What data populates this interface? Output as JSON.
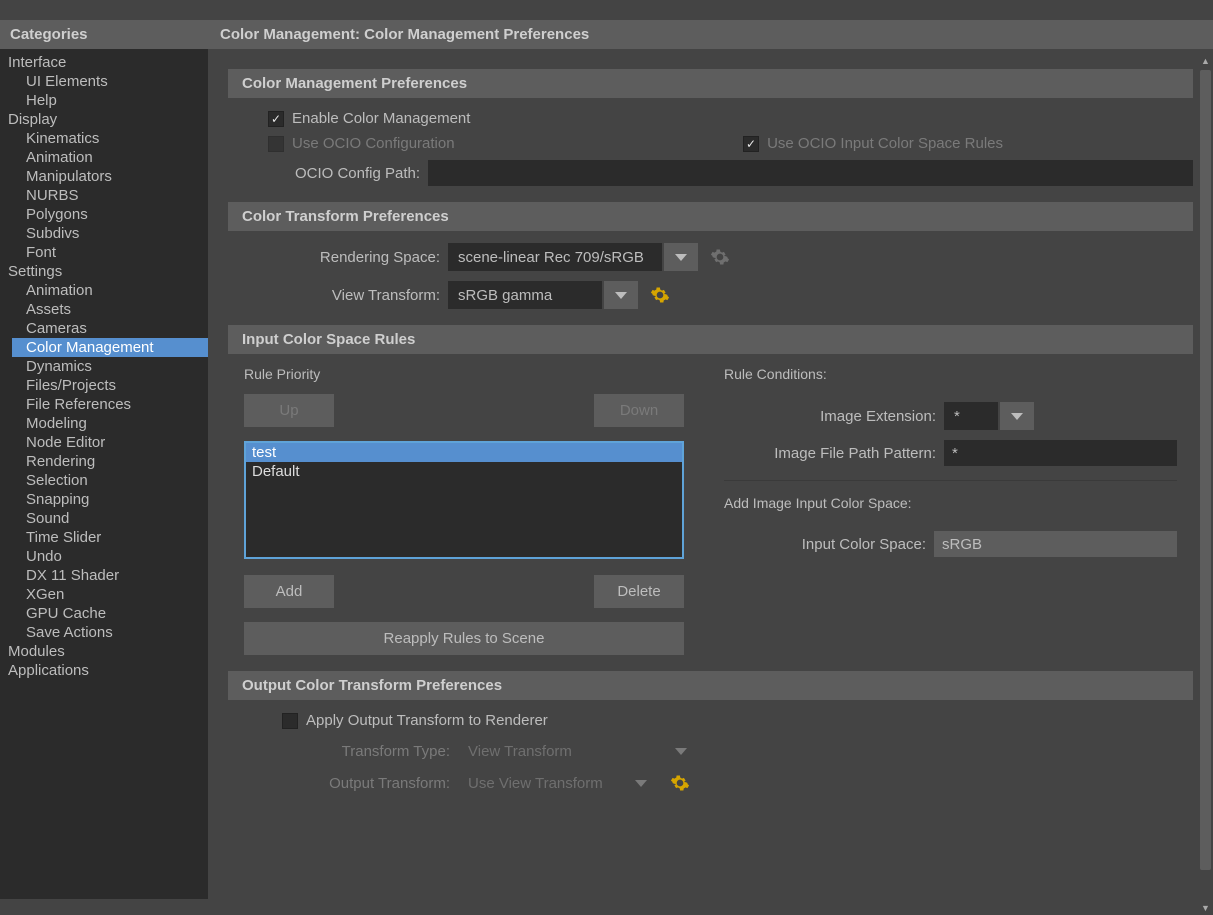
{
  "sidebar": {
    "header": "Categories",
    "groups": [
      {
        "label": "Interface",
        "items": [
          "UI Elements",
          "Help"
        ]
      },
      {
        "label": "Display",
        "items": [
          "Kinematics",
          "Animation",
          "Manipulators",
          "NURBS",
          "Polygons",
          "Subdivs",
          "Font"
        ]
      },
      {
        "label": "Settings",
        "items": [
          "Animation",
          "Assets",
          "Cameras",
          "Color Management",
          "Dynamics",
          "Files/Projects",
          "File References",
          "Modeling",
          "Node Editor",
          "Rendering",
          "Selection",
          "Snapping",
          "Sound",
          "Time Slider",
          "Undo",
          "DX 11 Shader",
          "XGen",
          "GPU Cache",
          "Save Actions"
        ]
      },
      {
        "label": "Modules",
        "items": []
      },
      {
        "label": "Applications",
        "items": []
      }
    ],
    "selected": "Color Management"
  },
  "header": "Color Management: Color Management Preferences",
  "sections": {
    "cm_prefs": {
      "title": "Color Management Preferences",
      "enable_label": "Enable Color Management",
      "enable_checked": true,
      "use_ocio_config_label": "Use OCIO Configuration",
      "use_ocio_config_checked": false,
      "use_ocio_rules_label": "Use OCIO Input Color Space Rules",
      "use_ocio_rules_checked": true,
      "ocio_path_label": "OCIO Config Path:",
      "ocio_path_value": ""
    },
    "ct_prefs": {
      "title": "Color Transform Preferences",
      "rendering_space_label": "Rendering Space:",
      "rendering_space_value": "scene-linear Rec 709/sRGB",
      "view_transform_label": "View Transform:",
      "view_transform_value": "sRGB gamma"
    },
    "rules": {
      "title": "Input Color Space Rules",
      "priority_label": "Rule Priority",
      "up": "Up",
      "down": "Down",
      "list": [
        "test",
        "Default"
      ],
      "add": "Add",
      "delete": "Delete",
      "reapply": "Reapply Rules to Scene",
      "conditions_label": "Rule Conditions:",
      "ext_label": "Image Extension:",
      "ext_value": "*",
      "path_label": "Image File Path Pattern:",
      "path_value": "*",
      "add_space_label": "Add Image Input Color Space:",
      "input_cs_label": "Input Color Space:",
      "input_cs_value": "sRGB"
    },
    "out_prefs": {
      "title": "Output Color Transform Preferences",
      "apply_label": "Apply Output Transform to Renderer",
      "apply_checked": false,
      "transform_type_label": "Transform Type:",
      "transform_type_value": "View Transform",
      "output_transform_label": "Output Transform:",
      "output_transform_value": "Use View Transform"
    }
  }
}
